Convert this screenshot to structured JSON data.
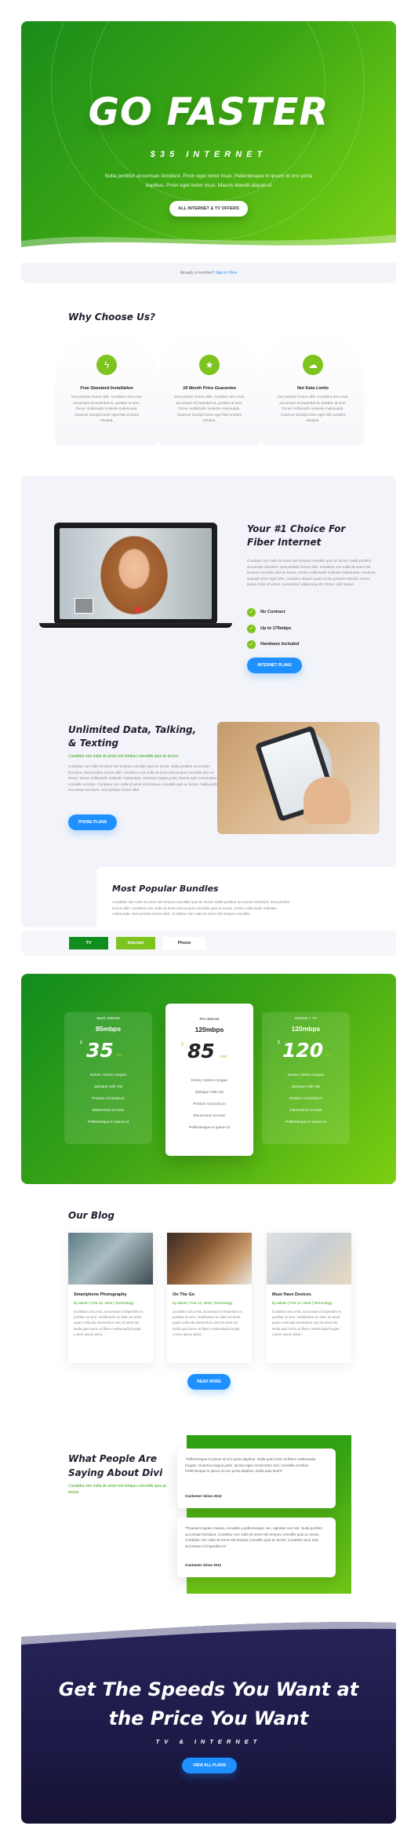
{
  "hero": {
    "title": "GO FASTER",
    "subtitle": "$35 INTERNET",
    "body": "Nulla porttitor accumsan tincidunt. Proin eget tortor risus. Pellentesque in ipsum id orci porta dapibus. Proin eget tortor risus. Mauris blandit aliquet el",
    "button": "ALL INTERNET & TV OFFERS"
  },
  "member_bar": {
    "text": "Already a member?",
    "link": "Sign in Here"
  },
  "why": {
    "title": "Why Choose Us?",
    "features": [
      {
        "icon": "bolt-icon",
        "glyph": "ϟ",
        "title": "Free Standard Installation",
        "body": "Sed porttitor lectus nibh. Curabitur arcu erat, accumsan id imperdiet et, porttitor at sem. Donec sollicitudin molestie malesuada. Vivamus suscipit tortor eget felis porttitor volutpat."
      },
      {
        "icon": "star-icon",
        "glyph": "★",
        "title": "18 Month Price Guarantee",
        "body": "Sed porttitor lectus nibh. Curabitur arcu erat, accumsan id imperdiet et, porttitor at sem. Donec sollicitudin molestie malesuada. Vivamus suscipit tortor eget felis porttitor volutpat."
      },
      {
        "icon": "cloud-icon",
        "glyph": "☁",
        "title": "Not Data Limits",
        "body": "Sed porttitor lectus nibh. Curabitur arcu erat, accumsan id imperdiet et, porttitor at sem. Donec sollicitudin molestie malesuada. Vivamus suscipit tortor eget felis porttitor volutpat."
      }
    ]
  },
  "choice": {
    "title": "Your #1 Choice For Fiber Internet",
    "body": "Curabitur non nulla sit amet nisl tempus convallis quis ac lectus. Nulla porttitor accumsan tincidunt. Sed porttitor lectus nibh. Curabitur non nulla sit amet nisl tempus convallis quis ac lectus. Donec sollicitudin molestie malesuada. Vivamus suscipit tortor eget felis. Curabitur aliquet quam id dui posuere blandit. Lorem ipsum dolor sit amet, consectetur adipiscing elit. Donec velit neque.",
    "checks": [
      "No Contract",
      "Up to 175mbps",
      "Hardware Included"
    ],
    "button": "INTERNET PLANS"
  },
  "unlimited": {
    "title": "Unlimited Data, Talking, & Texting",
    "green": "Curabitur non nulla sit amet nisl tempus convallis quis ac lectus.",
    "body": "Curabitur non nulla sit amet nisl tempus convallis quis ac lectus. Nulla porttitor accumsan tincidunt. Sed porttitor lectus nibh. Curabitur non nulla sit amet nisl tempus convallis quis ac lectus. Donec sollicitudin molestie malesuada. Vivamus magna justo, lacinia eget consectetur sed, convallis at tellus. Curabitur non nulla sit amet nisl tempus convallis quis ac lectus. Nulla porttitor accumsan tincidunt. Sed porttitor lectus nibh.",
    "button": "PHONE PLANS"
  },
  "bundles": {
    "title": "Most Popular Bundles",
    "body": "Curabitur non nulla sit amet nisl tempus convallis quis ac lectus. Nulla porttitor accumsan tincidunt. Sed porttitor lectus nibh. Curabitur non nulla sit amet nisl tempus convallis quis ac lectus. Donec sollicitudin molestie malesuada. Sed porttitor lectus nibh. Curabitur non nulla sit amet nisl tempus convallis.",
    "tabs": [
      "TV",
      "Internet",
      "Phone"
    ]
  },
  "plans": [
    {
      "name": "Basic Internet",
      "speed": "85mbps",
      "price": "35",
      "per": "/mo",
      "features": [
        "Donec rutrum congue",
        "Quisque velit nisi",
        "Pretium ut lacinia in",
        "Elementum id enim",
        "Pellentesque in ipsum id"
      ]
    },
    {
      "name": "Pro Internet",
      "speed": "120mbps",
      "price": "85",
      "per": "/mo",
      "features": [
        "Donec rutrum congue",
        "Quisque velit nisi",
        "Pretium ut lacinia in",
        "Elementum id enim",
        "Pellentesque in ipsum id"
      ]
    },
    {
      "name": "Internet + TV",
      "speed": "120mbps",
      "price": "120",
      "per": "/mo",
      "features": [
        "Donec rutrum congue",
        "Quisque velit nisi",
        "Pretium ut lacinia in",
        "Elementum id enim",
        "Pellentesque in ipsum id"
      ]
    }
  ],
  "plan_currency": "$",
  "blog": {
    "title": "Our Blog",
    "posts": [
      {
        "title": "Smartphone Photography",
        "meta": "by admin | Feb 13, 2019 | Technology",
        "body": "Curabitur arcu erat, accumsan id imperdiet et, porttitor at sem. Vestibulum ac diam sit amet quam vehicula elementum sed sit amet dui. Nulla quis lorem ut libero malesuada feugiat. Lorem ipsum dolor..."
      },
      {
        "title": "On The Go",
        "meta": "by admin | Feb 13, 2019 | Technology",
        "body": "Curabitur arcu erat, accumsan id imperdiet et, porttitor at sem. Vestibulum ac diam sit amet quam vehicula elementum sed sit amet dui. Nulla quis lorem ut libero malesuada feugiat. Lorem ipsum dolor..."
      },
      {
        "title": "Must Have Devices",
        "meta": "by admin | Feb 13, 2019 | Technology",
        "body": "Curabitur arcu erat, accumsan id imperdiet et, porttitor at sem. Vestibulum ac diam sit amet quam vehicula elementum sed sit amet dui. Nulla quis lorem ut libero malesuada feugiat. Lorem ipsum dolor..."
      }
    ],
    "button": "READ MORE"
  },
  "testimonials": {
    "title": "What People Are Saying About Divi",
    "green": "Curabitur non nulla sit amet nisl tempus convallis quis ac lectus.",
    "quotes": [
      {
        "text": "\"Pellentesque in ipsum id orci porta dapibus. Nulla quis lorem ut libero malesuada feugiat. Vivamus magna justo, lacinia eget consectetur sed, convallis at tellus. Pellentesque in ipsum id orci porta dapibus. Nulla quis lorem\"",
        "author": "Customer Since 2014"
      },
      {
        "text": "\"Praesent sapien massa, convallis a pellentesque nec, egestas non nisi. Nulla porttitor accumsan tincidunt. Curabitur non nulla sit amet nisl tempus convallis quis ac lectus. Curabitur non nulla sit amet nisl tempus convallis quis ac lectus. Curabitur arcu erat, accumsan id imperdiet et.\"",
        "author": "Customer Since 2011"
      }
    ]
  },
  "cta": {
    "line1": "Get The Speeds You Want at",
    "line2": "the Price You Want",
    "sub": "TV & INTERNET",
    "button": "VIEW ALL PLANS"
  },
  "colors": {
    "green": "#7ec41e",
    "blue": "#1e90ff",
    "navy": "#1d1a47"
  }
}
